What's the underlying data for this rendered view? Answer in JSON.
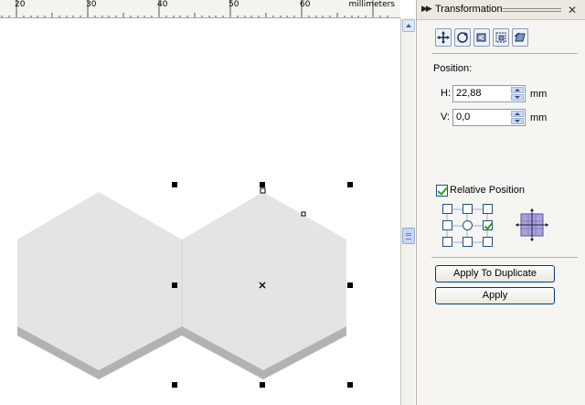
{
  "ruler": {
    "ticks": [
      "20",
      "30",
      "40",
      "50",
      "60"
    ],
    "unit": "millimeters"
  },
  "canvas": {
    "shape_fill": "#e4e4e4",
    "shape_shadow": "#b2b2b2",
    "handle_color": "#000000"
  },
  "docker": {
    "title": "Transformation",
    "toolbar": {
      "position_tool": "position-icon",
      "rotate_tool": "rotate-icon",
      "scale_mirror_tool": "scale-mirror-icon",
      "size_tool": "size-icon",
      "skew_tool": "skew-icon"
    },
    "position_label": "Position:",
    "h_label": "H:",
    "h_value": "22,88",
    "h_unit": "mm",
    "v_label": "V:",
    "v_value": "0,0",
    "v_unit": "mm",
    "relative_label": "Relative Position",
    "relative_checked": true,
    "anchor_grid": {
      "selected": "middle-right"
    },
    "apply_to_duplicate_label": "Apply To Duplicate",
    "apply_label": "Apply"
  },
  "colors": {
    "checkmark": "#21a121",
    "button_border": "#003c74",
    "spin_button": "#c9d8f5"
  }
}
